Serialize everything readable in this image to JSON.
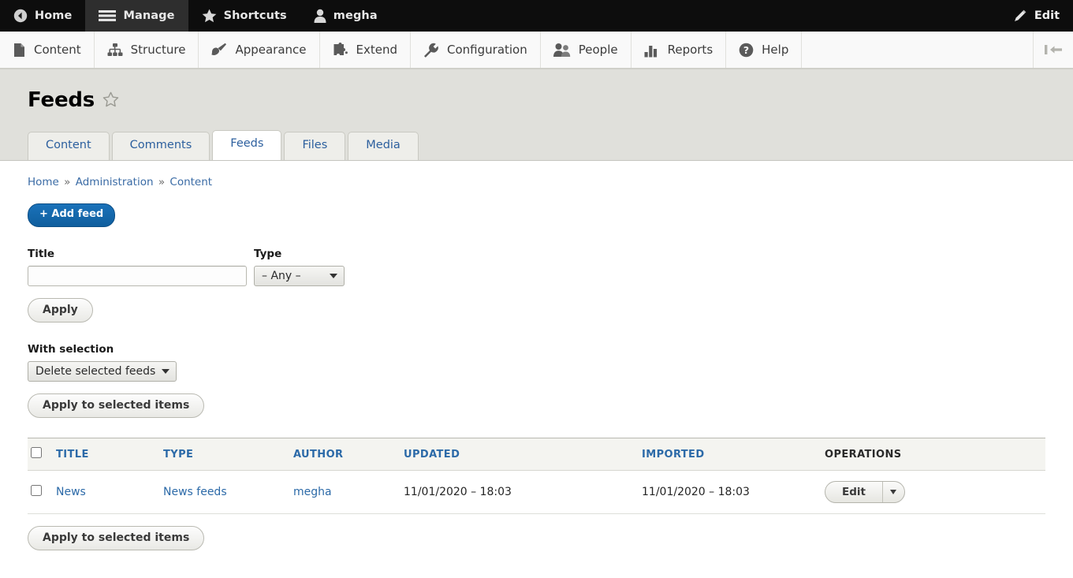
{
  "toolbar": {
    "home": "Home",
    "manage": "Manage",
    "shortcuts": "Shortcuts",
    "user": "megha",
    "edit": "Edit",
    "icons": {
      "home": "back-circle-icon",
      "manage": "hamburger-icon",
      "shortcuts": "star-icon",
      "user": "person-icon",
      "edit": "pencil-icon",
      "collapse": "collapse-toolbar-icon"
    }
  },
  "menu": {
    "items": [
      {
        "label": "Content",
        "icon": "document-icon"
      },
      {
        "label": "Structure",
        "icon": "sitemap-icon"
      },
      {
        "label": "Appearance",
        "icon": "paintbrush-icon"
      },
      {
        "label": "Extend",
        "icon": "puzzle-icon"
      },
      {
        "label": "Configuration",
        "icon": "wrench-icon"
      },
      {
        "label": "People",
        "icon": "people-icon"
      },
      {
        "label": "Reports",
        "icon": "bar-chart-icon"
      },
      {
        "label": "Help",
        "icon": "question-circle-icon"
      }
    ]
  },
  "page": {
    "title": "Feeds",
    "star_icon": "star-outline-icon"
  },
  "tabs": [
    {
      "label": "Content",
      "active": false
    },
    {
      "label": "Comments",
      "active": false
    },
    {
      "label": "Feeds",
      "active": true
    },
    {
      "label": "Files",
      "active": false
    },
    {
      "label": "Media",
      "active": false
    }
  ],
  "breadcrumb": {
    "items": [
      "Home",
      "Administration",
      "Content"
    ],
    "separator": "»"
  },
  "actions": {
    "add_feed": "+ Add feed"
  },
  "filters": {
    "title_label": "Title",
    "title_value": "",
    "title_placeholder": "",
    "type_label": "Type",
    "type_value": "– Any –",
    "type_options": [
      "– Any –"
    ],
    "apply_label": "Apply"
  },
  "bulk": {
    "label": "With selection",
    "action_value": "Delete selected feeds",
    "action_options": [
      "Delete selected feeds"
    ],
    "apply_label": "Apply to selected items",
    "apply_label_bottom": "Apply to selected items"
  },
  "table": {
    "columns": [
      {
        "key": "select",
        "label": "",
        "sortable": false
      },
      {
        "key": "title",
        "label": "TITLE",
        "sortable": true
      },
      {
        "key": "type",
        "label": "TYPE",
        "sortable": true
      },
      {
        "key": "author",
        "label": "AUTHOR",
        "sortable": true
      },
      {
        "key": "updated",
        "label": "UPDATED",
        "sortable": true
      },
      {
        "key": "imported",
        "label": "IMPORTED",
        "sortable": true
      },
      {
        "key": "operations",
        "label": "OPERATIONS",
        "sortable": false
      }
    ],
    "rows": [
      {
        "selected": false,
        "title": "News",
        "type": "News feeds",
        "author": "megha",
        "updated": "11/01/2020 – 18:03",
        "imported": "11/01/2020 – 18:03",
        "operation_label": "Edit"
      }
    ]
  },
  "colors": {
    "toolbar_bg": "#0d0d0d",
    "link": "#2c6aa8",
    "action_button": "#0f5e9e",
    "header_band": "#e0e0db"
  }
}
